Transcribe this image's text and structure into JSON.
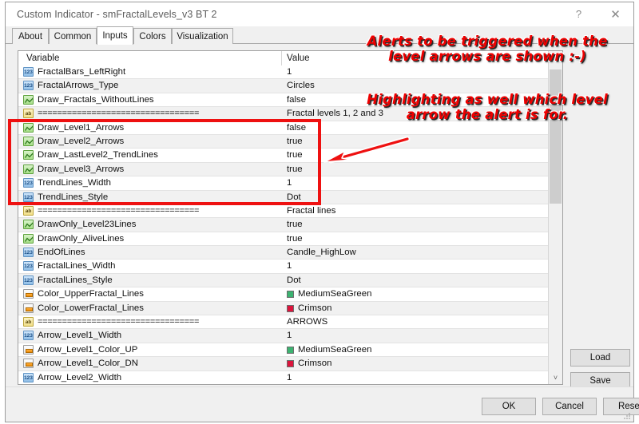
{
  "window": {
    "title": "Custom Indicator - smFractalLevels_v3 BT 2",
    "help_label": "?",
    "close_label": "✕"
  },
  "tabs": [
    {
      "label": "About",
      "active": false
    },
    {
      "label": "Common",
      "active": false
    },
    {
      "label": "Inputs",
      "active": true
    },
    {
      "label": "Colors",
      "active": false
    },
    {
      "label": "Visualization",
      "active": false
    }
  ],
  "table": {
    "headers": {
      "variable": "Variable",
      "value": "Value"
    },
    "rows": [
      {
        "icon": "int-icon",
        "name": "FractalBars_LeftRight",
        "value": "1"
      },
      {
        "icon": "int-icon",
        "name": "FractalArrows_Type",
        "value": "Circles"
      },
      {
        "icon": "bool-icon",
        "name": "Draw_Fractals_WithoutLines",
        "value": "false"
      },
      {
        "icon": "string-icon",
        "name": "=================================",
        "value": "Fractal levels 1, 2 and 3",
        "separator": true
      },
      {
        "icon": "bool-icon",
        "name": "Draw_Level1_Arrows",
        "value": "false"
      },
      {
        "icon": "bool-icon",
        "name": "Draw_Level2_Arrows",
        "value": "true"
      },
      {
        "icon": "bool-icon",
        "name": "Draw_LastLevel2_TrendLines",
        "value": "true"
      },
      {
        "icon": "bool-icon",
        "name": "Draw_Level3_Arrows",
        "value": "true"
      },
      {
        "icon": "int-icon",
        "name": "TrendLines_Width",
        "value": "1"
      },
      {
        "icon": "int-icon",
        "name": "TrendLines_Style",
        "value": "Dot"
      },
      {
        "icon": "string-icon",
        "name": "=================================",
        "value": "Fractal lines",
        "separator": true
      },
      {
        "icon": "bool-icon",
        "name": "DrawOnly_Level23Lines",
        "value": "true"
      },
      {
        "icon": "bool-icon",
        "name": "DrawOnly_AliveLines",
        "value": "true"
      },
      {
        "icon": "int-icon",
        "name": "EndOfLines",
        "value": "Candle_HighLow"
      },
      {
        "icon": "int-icon",
        "name": "FractalLines_Width",
        "value": "1"
      },
      {
        "icon": "int-icon",
        "name": "FractalLines_Style",
        "value": "Dot"
      },
      {
        "icon": "color-icon",
        "name": "Color_UpperFractal_Lines",
        "value": "MediumSeaGreen",
        "swatch": "#3cb371"
      },
      {
        "icon": "color-icon",
        "name": "Color_LowerFractal_Lines",
        "value": "Crimson",
        "swatch": "#dc143c"
      },
      {
        "icon": "string-icon",
        "name": "=================================",
        "value": "ARROWS",
        "separator": true
      },
      {
        "icon": "int-icon",
        "name": "Arrow_Level1_Width",
        "value": "1"
      },
      {
        "icon": "color-icon",
        "name": "Arrow_Level1_Color_UP",
        "value": "MediumSeaGreen",
        "swatch": "#3cb371"
      },
      {
        "icon": "color-icon",
        "name": "Arrow_Level1_Color_DN",
        "value": "Crimson",
        "swatch": "#dc143c"
      },
      {
        "icon": "int-icon",
        "name": "Arrow_Level2_Width",
        "value": "1"
      }
    ]
  },
  "side_buttons": {
    "load": "Load",
    "save": "Save"
  },
  "footer_buttons": {
    "ok": "OK",
    "cancel": "Cancel",
    "reset": "Reset"
  },
  "annotations": {
    "callout_top": "Alerts to be triggered when the\nlevel arrows are shown :-)",
    "callout_bottom": "Highlighting as well which level\narrow the alert is for.",
    "highlight_color": "#ee1111",
    "text_color": "#ee0000"
  },
  "scrollbar": {
    "up_arrow": "˄",
    "down_arrow": "˅"
  }
}
